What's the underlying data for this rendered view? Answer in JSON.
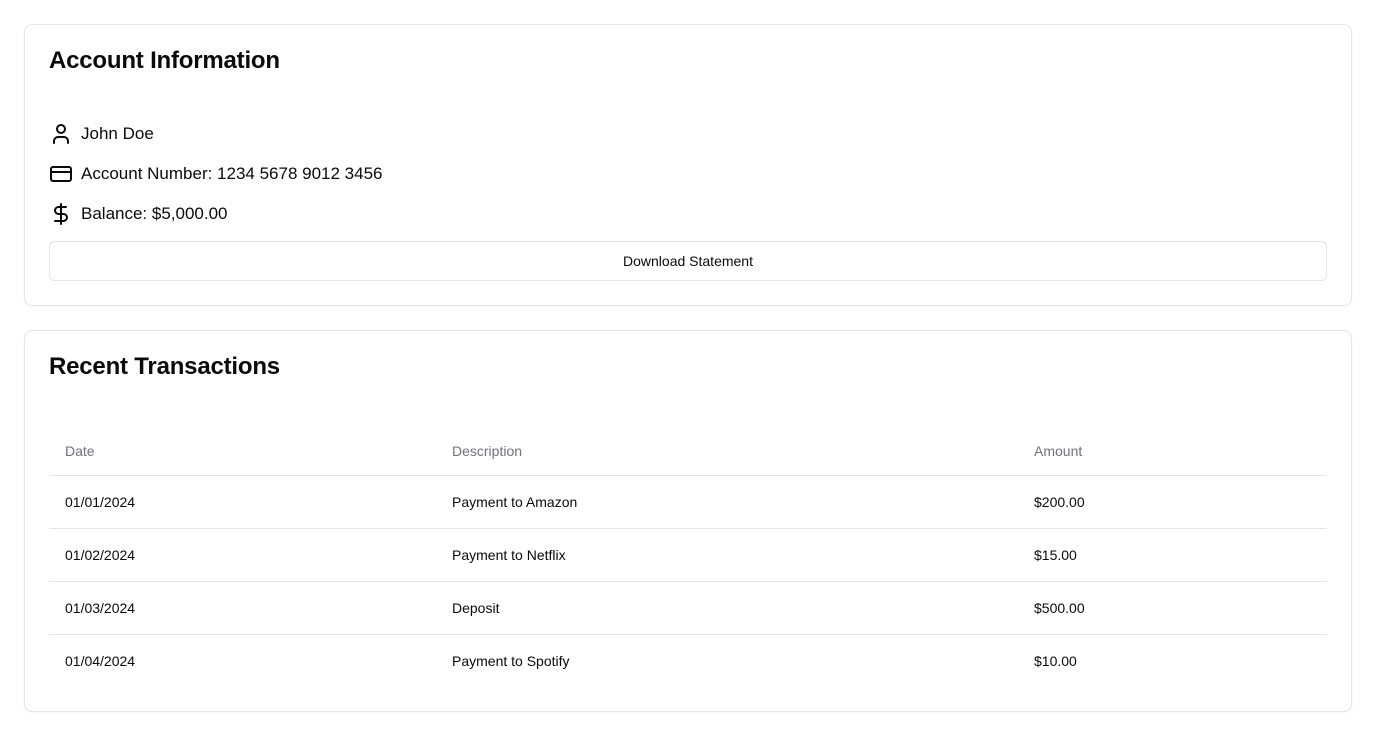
{
  "account": {
    "title": "Account Information",
    "name": "John Doe",
    "account_number": "Account Number: 1234 5678 9012 3456",
    "balance": "Balance: $5,000.00",
    "download_label": "Download Statement",
    "icons": {
      "name": "user-icon",
      "account_number": "credit-card-icon",
      "balance": "dollar-sign-icon"
    }
  },
  "transactions": {
    "title": "Recent Transactions",
    "columns": [
      "Date",
      "Description",
      "Amount"
    ],
    "rows": [
      {
        "date": "01/01/2024",
        "description": "Payment to Amazon",
        "amount": "$200.00"
      },
      {
        "date": "01/02/2024",
        "description": "Payment to Netflix",
        "amount": "$15.00"
      },
      {
        "date": "01/03/2024",
        "description": "Deposit",
        "amount": "$500.00"
      },
      {
        "date": "01/04/2024",
        "description": "Payment to Spotify",
        "amount": "$10.00"
      }
    ]
  },
  "colors": {
    "border": "#e4e4e7",
    "text": "#0a0a0a",
    "muted": "#71717a"
  }
}
